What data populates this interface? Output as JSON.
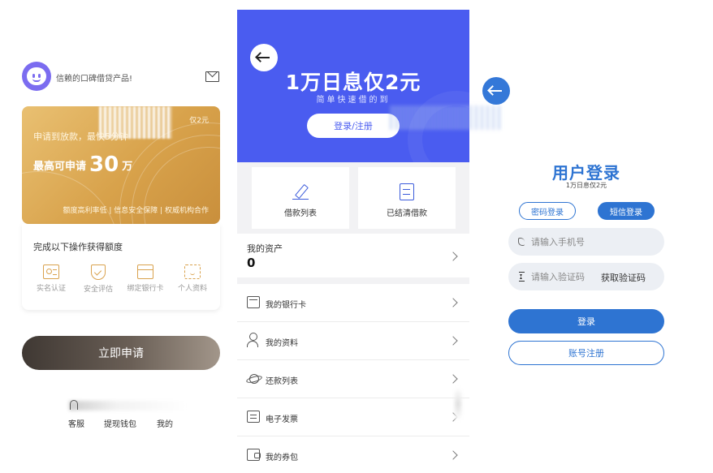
{
  "home": {
    "slogan": "信赖的口碑借贷产品!",
    "card": {
      "promo": "仅2元",
      "subtitle": "申请到放款，最快5分钟",
      "amount_prefix": "最高可申请",
      "amount_value": "30",
      "amount_unit": "万",
      "footer": "额度高利率低 | 信息安全保障 | 权威机构合作"
    },
    "tasks_title": "完成以下操作获得额度",
    "tasks": [
      {
        "label": "实名认证",
        "icon": "id-card-icon"
      },
      {
        "label": "安全评估",
        "icon": "shield-check-icon"
      },
      {
        "label": "绑定银行卡",
        "icon": "bank-card-icon"
      },
      {
        "label": "个人资料",
        "icon": "face-scan-icon"
      }
    ],
    "apply_button": "立即申请",
    "tabs": [
      "客服",
      "提现钱包",
      "我的"
    ]
  },
  "account": {
    "banner_title": "1万日息仅2元",
    "banner_sub": "简单快速借的到",
    "login_register": "登录/注册",
    "quick": [
      {
        "label": "借款列表",
        "icon": "pen-icon"
      },
      {
        "label": "已结清借款",
        "icon": "document-icon"
      }
    ],
    "assets_label": "我的资产",
    "assets_value": "0",
    "menu": [
      {
        "label": "我的银行卡",
        "icon": "bank-card-icon"
      },
      {
        "label": "我的资料",
        "icon": "user-icon"
      },
      {
        "label": "还款列表",
        "icon": "planet-icon"
      },
      {
        "label": "电子发票",
        "icon": "ticket-icon"
      },
      {
        "label": "我的券包",
        "icon": "wallet-icon"
      }
    ]
  },
  "login": {
    "title": "用户登录",
    "subtitle": "1万日息仅2元",
    "mode_password": "密码登录",
    "mode_sms": "短信登录",
    "phone_placeholder": "请输入手机号",
    "code_placeholder": "请输入验证码",
    "get_code": "获取验证码",
    "login_button": "登录",
    "register_button": "账号注册"
  },
  "colors": {
    "gold": "#d8a24b",
    "banner_blue": "#4a5cf0",
    "login_blue": "#2e74d2",
    "apply_dark": "#4a423c"
  }
}
